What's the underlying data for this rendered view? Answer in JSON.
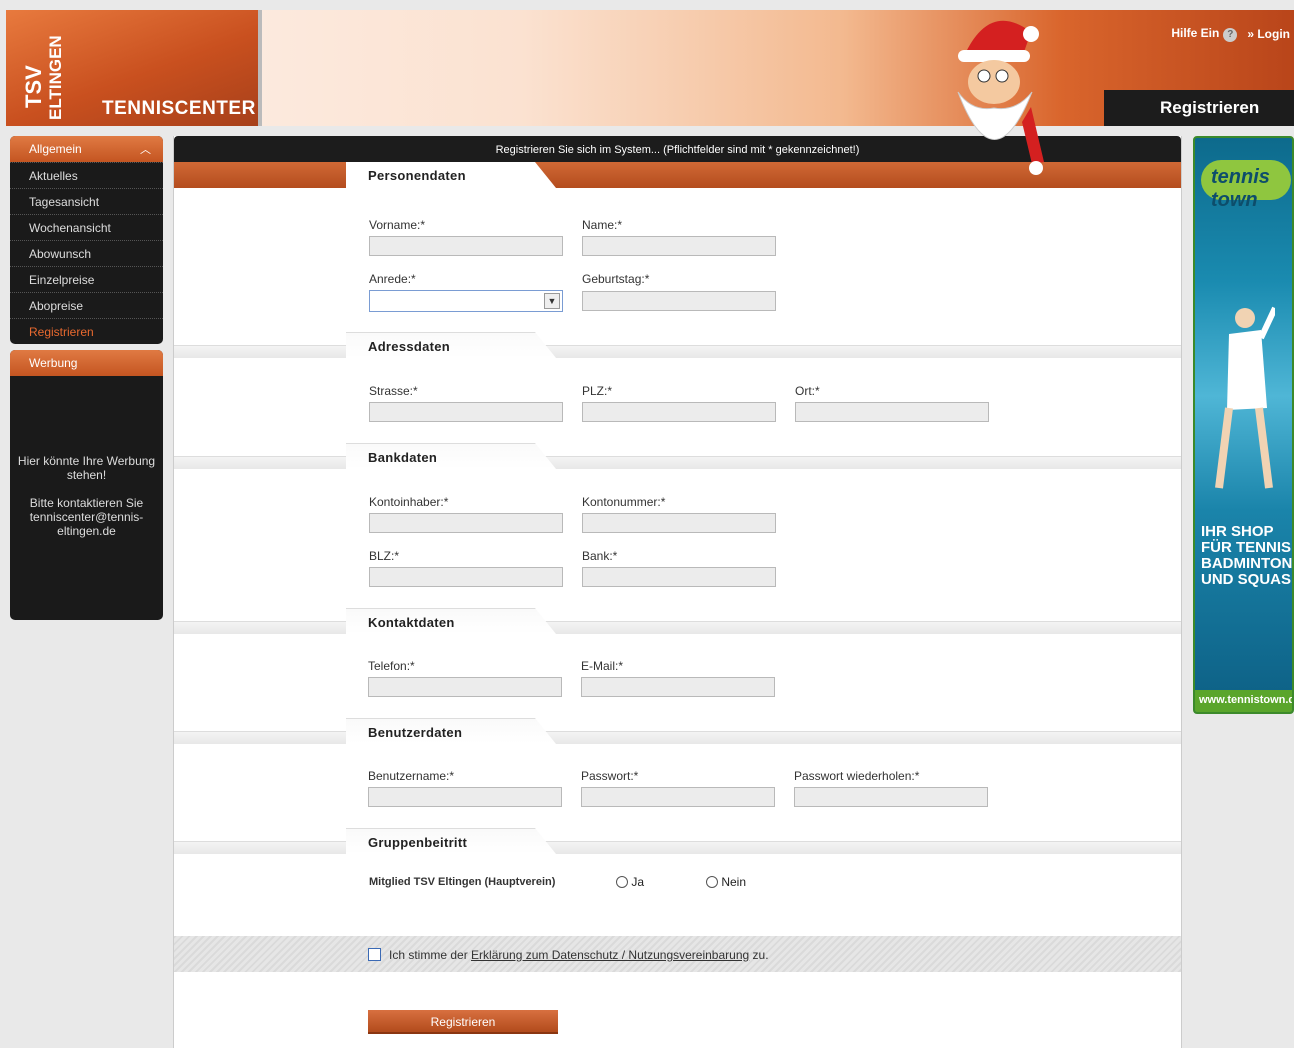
{
  "header": {
    "logo_line1": "TSV",
    "logo_line2": "ELTINGEN",
    "title": "TENNISCENTER",
    "help_label": "Hilfe Ein",
    "help_icon": "?",
    "login_label": "Login",
    "page_heading": "Registrieren"
  },
  "sidebar": {
    "menu_title": "Allgemein",
    "items": [
      {
        "label": "Aktuelles"
      },
      {
        "label": "Tagesansicht"
      },
      {
        "label": "Wochenansicht"
      },
      {
        "label": "Abowunsch"
      },
      {
        "label": "Einzelpreise"
      },
      {
        "label": "Abopreise"
      },
      {
        "label": "Registrieren"
      }
    ],
    "ad_title": "Werbung",
    "ad_line1": "Hier könnte Ihre Werbung stehen!",
    "ad_line2": "Bitte kontaktieren Sie tenniscenter@tennis-eltingen.de"
  },
  "form": {
    "intro": "Registrieren Sie sich im System... (Pflichtfelder sind mit * gekennzeichnet!)",
    "sections": {
      "personal": "Personendaten",
      "address": "Adressdaten",
      "bank": "Bankdaten",
      "contact": "Kontaktdaten",
      "user": "Benutzerdaten",
      "group": "Gruppenbeitritt"
    },
    "labels": {
      "vorname": "Vorname:*",
      "name": "Name:*",
      "anrede": "Anrede:*",
      "geburtstag": "Geburtstag:*",
      "strasse": "Strasse:*",
      "plz": "PLZ:*",
      "ort": "Ort:*",
      "kontoinhaber": "Kontoinhaber:*",
      "kontonummer": "Kontonummer:*",
      "blz": "BLZ:*",
      "bank": "Bank:*",
      "telefon": "Telefon:*",
      "email": "E-Mail:*",
      "benutzername": "Benutzername:*",
      "passwort": "Passwort:*",
      "passwort2": "Passwort wiederholen:*",
      "mitglied": "Mitglied TSV Eltingen (Hauptverein)",
      "ja": "Ja",
      "nein": "Nein"
    },
    "anrede_value": "",
    "agree_prefix": "Ich stimme der ",
    "agree_link": "Erklärung zum Datenschutz / Nutzungsvereinbarung",
    "agree_suffix": " zu.",
    "submit_label": "Registrieren"
  },
  "right_ad": {
    "logo_text": "tennis town",
    "slogan_line1": "IHR SHOP",
    "slogan_line2": "FÜR TENNIS,",
    "slogan_line3": "BADMINTON",
    "slogan_line4": "UND SQUASH",
    "url": "www.tennistown.de"
  }
}
